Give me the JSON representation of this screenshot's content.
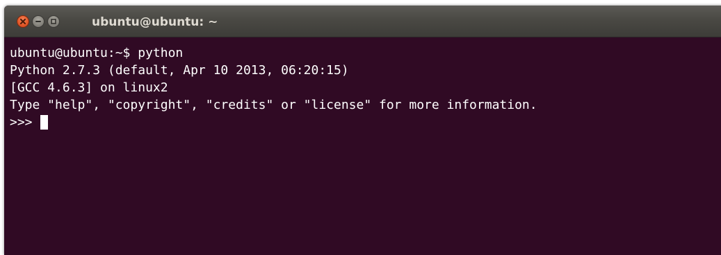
{
  "window": {
    "title": "ubuntu@ubuntu: ~",
    "controls": {
      "close_icon": "close-icon",
      "minimize_icon": "minimize-icon",
      "maximize_icon": "maximize-icon"
    },
    "colors": {
      "terminal_background": "#300a24",
      "terminal_text": "#ffffff",
      "titlebar": "#4a4944",
      "close_button": "#e45a2a"
    }
  },
  "terminal": {
    "lines": [
      "ubuntu@ubuntu:~$ python",
      "Python 2.7.3 (default, Apr 10 2013, 06:20:15)",
      "[GCC 4.6.3] on linux2",
      "Type \"help\", \"copyright\", \"credits\" or \"license\" for more information."
    ],
    "prompt": ">>>"
  }
}
